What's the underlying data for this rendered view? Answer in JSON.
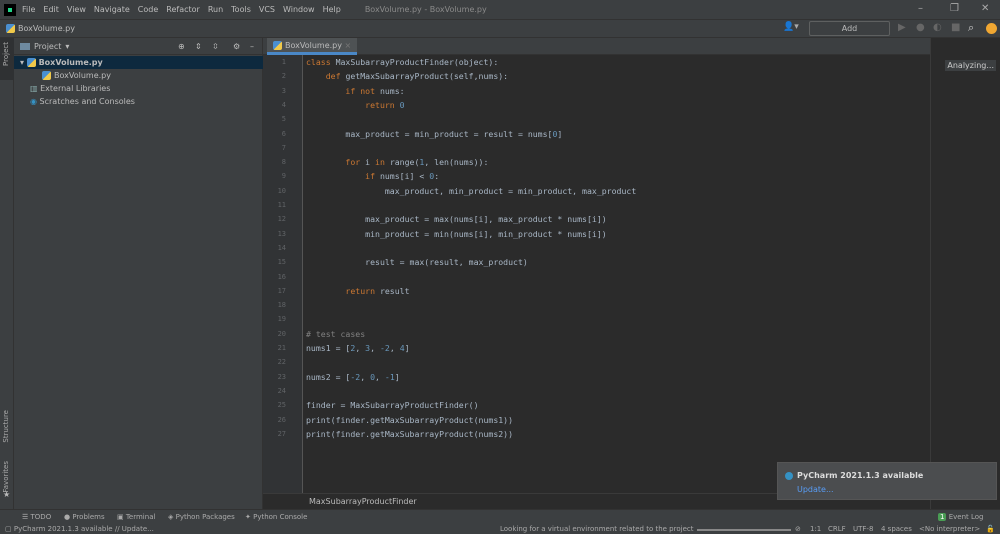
{
  "titlebar": {
    "menus": [
      "File",
      "Edit",
      "View",
      "Navigate",
      "Code",
      "Refactor",
      "Run",
      "Tools",
      "VCS",
      "Window",
      "Help"
    ],
    "title": "BoxVolume.py - BoxVolume.py"
  },
  "navbar": {
    "file": "BoxVolume.py",
    "add_config": "Add Configuration..."
  },
  "project": {
    "header": "Project",
    "tree": [
      "BoxVolume.py",
      "BoxVolume.py",
      "External Libraries",
      "Scratches and Consoles"
    ]
  },
  "sidestrip": {
    "project": "Project",
    "structure": "Structure",
    "favorites": "Favorites"
  },
  "editor": {
    "tab": "BoxVolume.py",
    "breadcrumb": "MaxSubarrayProductFinder",
    "status": "Analyzing...",
    "lines": [
      [
        [
          "class ",
          "kw"
        ],
        [
          "MaxSubarrayProductFinder(object):",
          ""
        ]
      ],
      [
        [
          "    def ",
          "kw"
        ],
        [
          "getMaxSubarrayProduct(self,nums):",
          ""
        ]
      ],
      [
        [
          "        if not ",
          "kw"
        ],
        [
          "nums:",
          ""
        ]
      ],
      [
        [
          "            return ",
          "kw"
        ],
        [
          "0",
          "num"
        ]
      ],
      [],
      [
        [
          "        max_product = min_product = result = nums[",
          ""
        ],
        [
          "0",
          "num"
        ],
        [
          "]",
          ""
        ]
      ],
      [],
      [
        [
          "        for ",
          "kw"
        ],
        [
          "i ",
          ""
        ],
        [
          "in ",
          "kw"
        ],
        [
          "range(",
          ""
        ],
        [
          "1",
          "num"
        ],
        [
          ", len(nums)):",
          ""
        ]
      ],
      [
        [
          "            if ",
          "kw"
        ],
        [
          "nums[i] < ",
          ""
        ],
        [
          "0",
          "num"
        ],
        [
          ":",
          ""
        ]
      ],
      [
        [
          "                max_product, min_product = min_product, max_product",
          ""
        ]
      ],
      [],
      [
        [
          "            max_product = max(nums[i], max_product * nums[i])",
          ""
        ]
      ],
      [
        [
          "            min_product = min(nums[i], min_product * nums[i])",
          ""
        ]
      ],
      [],
      [
        [
          "            result = max(result, max_product)",
          ""
        ]
      ],
      [],
      [
        [
          "        return ",
          "kw"
        ],
        [
          "result",
          ""
        ]
      ],
      [],
      [],
      [
        [
          "# test cases",
          "cm"
        ]
      ],
      [
        [
          "nums1 = [",
          ""
        ],
        [
          "2",
          "num"
        ],
        [
          ", ",
          ""
        ],
        [
          "3",
          "num"
        ],
        [
          ", ",
          ""
        ],
        [
          "-2",
          "num"
        ],
        [
          ", ",
          ""
        ],
        [
          "4",
          "num"
        ],
        [
          "]",
          ""
        ]
      ],
      [],
      [
        [
          "nums2 = [",
          ""
        ],
        [
          "-2",
          "num"
        ],
        [
          ", ",
          ""
        ],
        [
          "0",
          "num"
        ],
        [
          ", ",
          ""
        ],
        [
          "-1",
          "num"
        ],
        [
          "]",
          ""
        ]
      ],
      [],
      [
        [
          "finder = MaxSubarrayProductFinder()",
          ""
        ]
      ],
      [
        [
          "print(finder.getMaxSubarrayProduct(nums1))",
          ""
        ]
      ],
      [
        [
          "print(finder.getMaxSubarrayProduct(nums2))",
          ""
        ]
      ]
    ]
  },
  "bottom_tabs": [
    "TODO",
    "Problems",
    "Terminal",
    "Python Packages",
    "Python Console"
  ],
  "event_log": {
    "count": "1",
    "label": "Event Log"
  },
  "notification": {
    "title": "PyCharm 2021.1.3 available",
    "link": "Update..."
  },
  "statusbar": {
    "message": "PyCharm 2021.1.3 available // Update...",
    "progress_text": "Looking for a virtual environment related to the project",
    "position": "1:1",
    "line_sep": "CRLF",
    "encoding": "UTF-8",
    "indent": "4 spaces",
    "interpreter": "<No interpreter>"
  }
}
